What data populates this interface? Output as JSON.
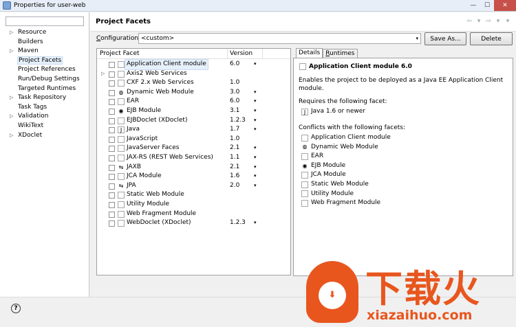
{
  "window": {
    "title": "Properties for user-web"
  },
  "left_nav": {
    "filter_placeholder": "",
    "items": [
      {
        "label": "Resource",
        "expandable": true
      },
      {
        "label": "Builders",
        "expandable": false
      },
      {
        "label": "Maven",
        "expandable": true
      },
      {
        "label": "Project Facets",
        "expandable": false,
        "selected": true
      },
      {
        "label": "Project References",
        "expandable": false
      },
      {
        "label": "Run/Debug Settings",
        "expandable": false
      },
      {
        "label": "Targeted Runtimes",
        "expandable": false
      },
      {
        "label": "Task Repository",
        "expandable": true
      },
      {
        "label": "Task Tags",
        "expandable": false
      },
      {
        "label": "Validation",
        "expandable": true
      },
      {
        "label": "WikiText",
        "expandable": false
      },
      {
        "label": "XDoclet",
        "expandable": true
      }
    ]
  },
  "header": {
    "title": "Project Facets"
  },
  "configuration": {
    "label_prefix": "C",
    "label_rest": "onfiguration:",
    "value": "<custom>",
    "save_as_label": "Save As...",
    "delete_label": "Delete"
  },
  "facets": {
    "col_facet": "Project Facet",
    "col_version": "Version",
    "rows": [
      {
        "name": "Application Client module",
        "version": "6.0",
        "has_dropdown": true,
        "icon": "module-icon",
        "selected": true
      },
      {
        "name": "Axis2 Web Services",
        "version": "",
        "has_dropdown": false,
        "icon": "module-icon",
        "expandable": true
      },
      {
        "name": "CXF 2.x Web Services",
        "version": "1.0",
        "has_dropdown": false,
        "icon": "module-icon"
      },
      {
        "name": "Dynamic Web Module",
        "version": "3.0",
        "has_dropdown": true,
        "icon": "globe-icon"
      },
      {
        "name": "EAR",
        "version": "6.0",
        "has_dropdown": true,
        "icon": "module-icon"
      },
      {
        "name": "EJB Module",
        "version": "3.1",
        "has_dropdown": true,
        "icon": "bean-icon"
      },
      {
        "name": "EJBDoclet (XDoclet)",
        "version": "1.2.3",
        "has_dropdown": true,
        "icon": "module-icon"
      },
      {
        "name": "Java",
        "version": "1.7",
        "has_dropdown": true,
        "icon": "java-icon"
      },
      {
        "name": "JavaScript",
        "version": "1.0",
        "has_dropdown": false,
        "icon": "module-icon"
      },
      {
        "name": "JavaServer Faces",
        "version": "2.1",
        "has_dropdown": true,
        "icon": "module-icon"
      },
      {
        "name": "JAX-RS (REST Web Services)",
        "version": "1.1",
        "has_dropdown": true,
        "icon": "module-icon"
      },
      {
        "name": "JAXB",
        "version": "2.1",
        "has_dropdown": true,
        "icon": "arrows-icon"
      },
      {
        "name": "JCA Module",
        "version": "1.6",
        "has_dropdown": true,
        "icon": "module-icon"
      },
      {
        "name": "JPA",
        "version": "2.0",
        "has_dropdown": true,
        "icon": "arrows-icon"
      },
      {
        "name": "Static Web Module",
        "version": "",
        "has_dropdown": false,
        "icon": "module-icon"
      },
      {
        "name": "Utility Module",
        "version": "",
        "has_dropdown": false,
        "icon": "module-icon"
      },
      {
        "name": "Web Fragment Module",
        "version": "",
        "has_dropdown": false,
        "icon": "module-icon"
      },
      {
        "name": "WebDoclet (XDoclet)",
        "version": "1.2.3",
        "has_dropdown": true,
        "icon": "module-icon"
      }
    ]
  },
  "details": {
    "tab_details": "Details",
    "tab_runtimes_prefix": "R",
    "tab_runtimes_rest": "untimes",
    "title": "Application Client module 6.0",
    "description": "Enables the project to be deployed as a Java EE Application Client module.",
    "requires_label": "Requires the following facet:",
    "requires": [
      {
        "name": "Java 1.6 or newer",
        "icon": "java-icon"
      }
    ],
    "conflicts_label": "Conflicts with the following facets:",
    "conflicts": [
      {
        "name": "Application Client module",
        "icon": "module-icon"
      },
      {
        "name": "Dynamic Web Module",
        "icon": "globe-icon"
      },
      {
        "name": "EAR",
        "icon": "module-icon"
      },
      {
        "name": "EJB Module",
        "icon": "bean-icon"
      },
      {
        "name": "JCA Module",
        "icon": "module-icon"
      },
      {
        "name": "Static Web Module",
        "icon": "module-icon"
      },
      {
        "name": "Utility Module",
        "icon": "module-icon"
      },
      {
        "name": "Web Fragment Module",
        "icon": "module-icon"
      }
    ]
  },
  "watermark": {
    "chinese_text": "下载火",
    "url": "xiazaihuo.com",
    "color": "#e8561e"
  },
  "icons": {
    "help": "?",
    "dropdown": "▾",
    "collapsed": "▷",
    "back": "⇦",
    "forward": "⇨",
    "minimize": "—",
    "maximize": "☐",
    "close": "✕"
  }
}
